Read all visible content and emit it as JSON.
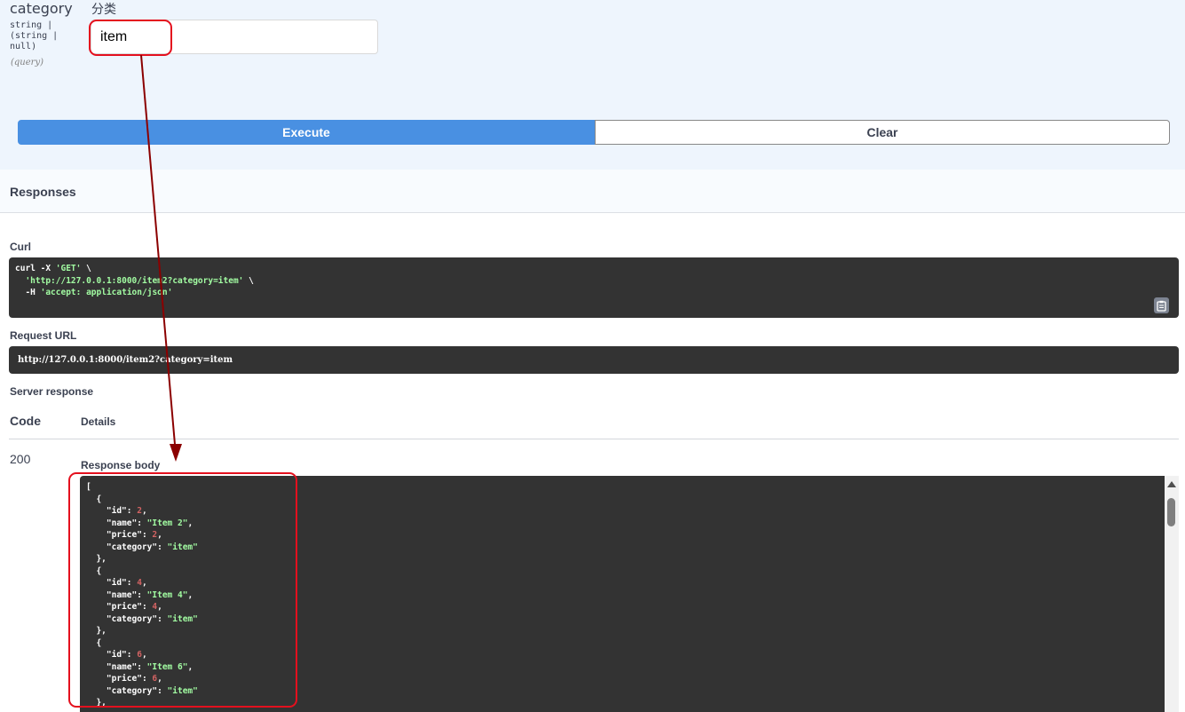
{
  "param": {
    "name": "category",
    "type": "string |\n(string |\nnull)",
    "location": "(query)",
    "description": "分类",
    "value": "item"
  },
  "buttons": {
    "execute": "Execute",
    "clear": "Clear"
  },
  "responses": {
    "title": "Responses",
    "curl_label": "Curl",
    "curl_lines": [
      {
        "prefix": "curl -X ",
        "str": "'GET'",
        "suffix": " \\"
      },
      {
        "prefix": "  ",
        "str": "'http://127.0.0.1:8000/item2?category=item'",
        "suffix": " \\"
      },
      {
        "prefix": "  -H ",
        "str": "'accept: application/json'",
        "suffix": ""
      }
    ],
    "request_url_label": "Request URL",
    "request_url": "http://127.0.0.1:8000/item2?category=item",
    "server_response_label": "Server response",
    "table_code_header": "Code",
    "table_details_header": "Details",
    "status_code": "200",
    "response_body_label": "Response body"
  },
  "response_items": [
    {
      "id": "2",
      "name": "\"Item 2\"",
      "price": "2",
      "category": "\"item\""
    },
    {
      "id": "4",
      "name": "\"Item 4\"",
      "price": "4",
      "category": "\"item\""
    },
    {
      "id": "6",
      "name": "\"Item 6\"",
      "price": "6",
      "category": "\"item\""
    }
  ],
  "json_keys": {
    "id": "\"id\"",
    "name": "\"name\"",
    "price": "\"price\"",
    "category": "\"category\""
  },
  "colors": {
    "execute": "#4990e2",
    "annotation": "#e4101e",
    "arrow": "#8b0000",
    "code_bg": "#333333",
    "string": "#a2fca2",
    "number": "#d36363"
  }
}
